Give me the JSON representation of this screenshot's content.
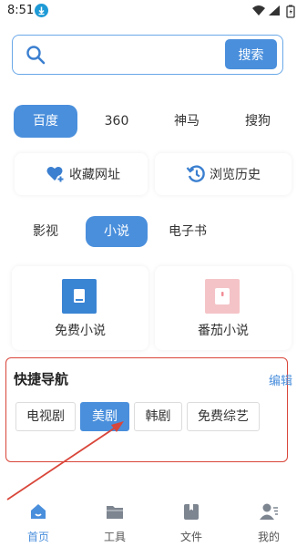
{
  "status_bar": {
    "time": "8:51"
  },
  "search": {
    "placeholder": "",
    "value": "",
    "button_label": "搜索"
  },
  "engines": [
    {
      "label": "百度",
      "active": true
    },
    {
      "label": "360",
      "active": false
    },
    {
      "label": "神马",
      "active": false
    },
    {
      "label": "搜狗",
      "active": false
    }
  ],
  "quick_actions": [
    {
      "label": "收藏网址",
      "icon": "heart-plus-icon"
    },
    {
      "label": "浏览历史",
      "icon": "history-icon"
    }
  ],
  "categories": [
    {
      "label": "影视",
      "active": false
    },
    {
      "label": "小说",
      "active": true
    },
    {
      "label": "电子书",
      "active": false
    }
  ],
  "novel_apps": [
    {
      "label": "免费小说",
      "icon": "book-icon",
      "color": "#3a84d4"
    },
    {
      "label": "番茄小说",
      "icon": "tomato-novel-icon",
      "color": "#f4c3c7"
    }
  ],
  "quick_nav": {
    "title": "快捷导航",
    "edit_label": "编辑",
    "items": [
      {
        "label": "电视剧",
        "active": false
      },
      {
        "label": "美剧",
        "active": true
      },
      {
        "label": "韩剧",
        "active": false
      },
      {
        "label": "免费综艺",
        "active": false
      }
    ]
  },
  "bottom_nav": [
    {
      "label": "首页",
      "icon": "home-icon",
      "active": true
    },
    {
      "label": "工具",
      "icon": "folder-icon",
      "active": false
    },
    {
      "label": "文件",
      "icon": "file-icon",
      "active": false
    },
    {
      "label": "我的",
      "icon": "profile-icon",
      "active": false
    }
  ],
  "colors": {
    "accent": "#4a8fdc",
    "annotation": "#d9463a"
  }
}
